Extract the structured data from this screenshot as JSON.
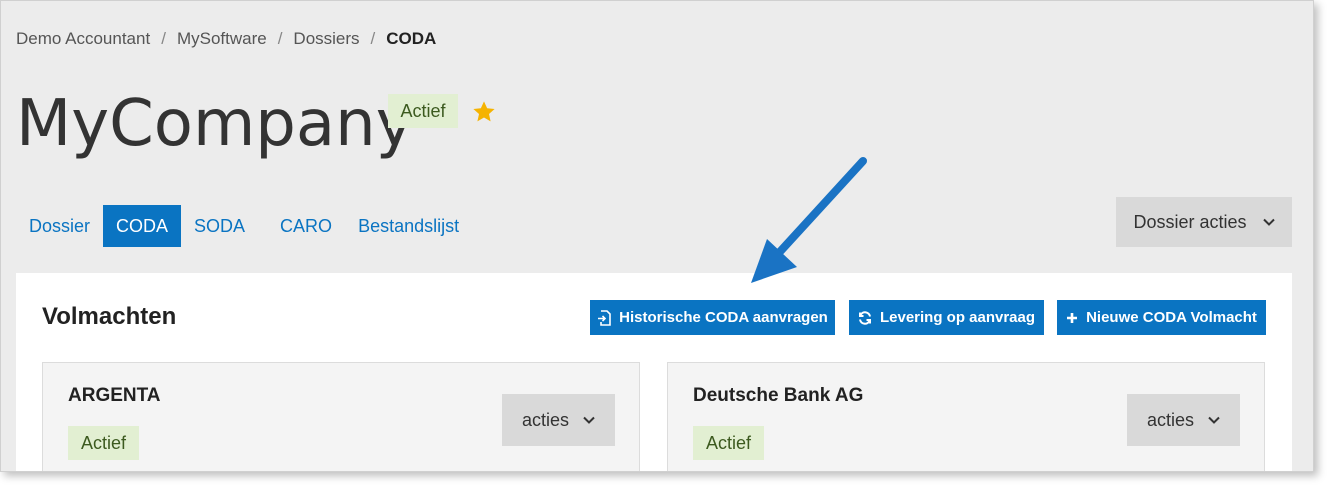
{
  "breadcrumb": {
    "items": [
      "Demo Accountant",
      "MySoftware",
      "Dossiers"
    ],
    "separator": "/",
    "current": "CODA"
  },
  "header": {
    "title": "MyCompany",
    "status_badge": "Actief",
    "favorite_icon": "star-icon"
  },
  "tabs": [
    {
      "label": "Dossier",
      "active": false
    },
    {
      "label": "CODA",
      "active": true
    },
    {
      "label": "SODA",
      "active": false
    },
    {
      "label": "CARO",
      "active": false
    },
    {
      "label": "Bestandslijst",
      "active": false
    }
  ],
  "dossier_actions": {
    "label": "Dossier acties",
    "icon": "chevron-down-icon"
  },
  "volmachten": {
    "title": "Volmachten",
    "buttons": {
      "historische": {
        "label": "Historische CODA aanvragen",
        "icon": "document-import-icon"
      },
      "levering": {
        "label": "Levering op aanvraag",
        "icon": "refresh-icon"
      },
      "nieuwe": {
        "label": "Nieuwe CODA Volmacht",
        "icon": "plus-icon"
      }
    },
    "cards": [
      {
        "bank": "ARGENTA",
        "status": "Actief",
        "actions_label": "acties"
      },
      {
        "bank": "Deutsche Bank AG",
        "status": "Actief",
        "actions_label": "acties"
      }
    ]
  },
  "colors": {
    "primary": "#0a74c2",
    "badge_bg": "#e2efd2",
    "badge_text": "#3c5a1f",
    "star": "#f5b301",
    "annotation_arrow": "#1a73c4"
  }
}
